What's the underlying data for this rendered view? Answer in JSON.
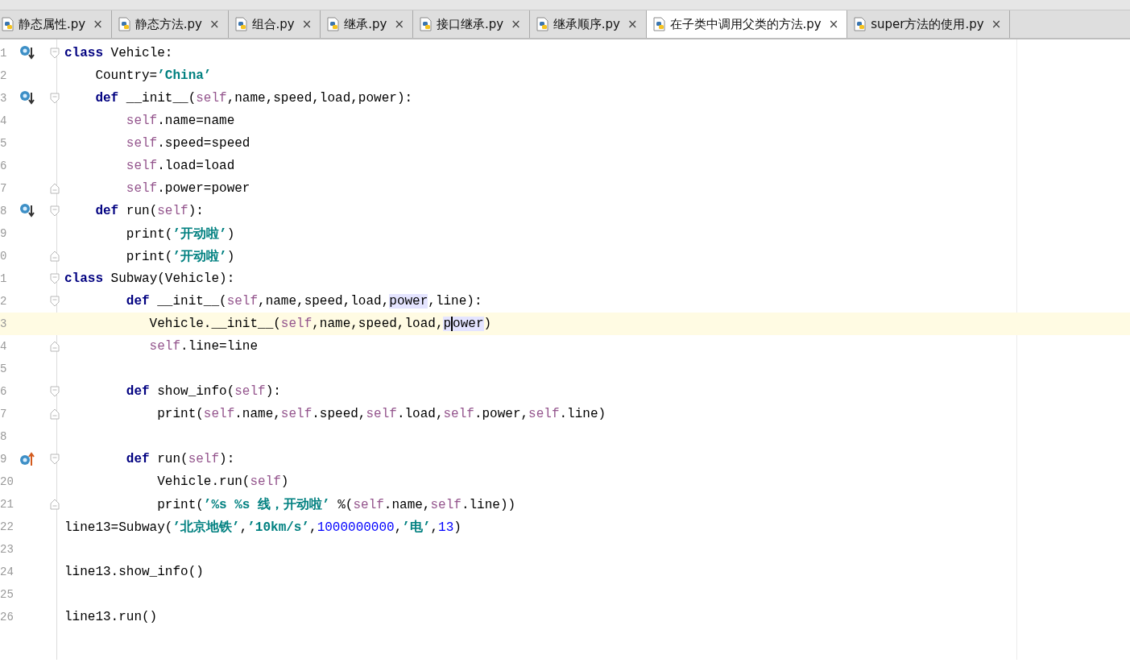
{
  "tabs": [
    {
      "label": "静态属性.py",
      "close": "×",
      "selected": false
    },
    {
      "label": "静态方法.py",
      "close": "×",
      "selected": false
    },
    {
      "label": "组合.py",
      "close": "×",
      "selected": false
    },
    {
      "label": "继承.py",
      "close": "×",
      "selected": false
    },
    {
      "label": "接口继承.py",
      "close": "×",
      "selected": false
    },
    {
      "label": "继承顺序.py",
      "close": "×",
      "selected": false
    },
    {
      "label": "在子类中调用父类的方法.py",
      "close": "×",
      "selected": true
    },
    {
      "label": "super方法的使用.py",
      "close": "×",
      "selected": false
    }
  ],
  "editor": {
    "lines": [
      {
        "number": "1",
        "current": false,
        "implemented": true,
        "overrides": false,
        "fold_start": true,
        "fold_end": false,
        "tokens": [
          {
            "kind": "kw",
            "text": "class"
          },
          {
            "kind": "plain",
            "text": " Vehicle:"
          }
        ]
      },
      {
        "number": "2",
        "current": false,
        "implemented": false,
        "overrides": false,
        "fold_start": false,
        "fold_end": false,
        "tokens": [
          {
            "kind": "plain",
            "text": "    Country="
          },
          {
            "kind": "str",
            "text": "’China’"
          }
        ]
      },
      {
        "number": "3",
        "current": false,
        "implemented": true,
        "overrides": false,
        "fold_start": true,
        "fold_end": false,
        "tokens": [
          {
            "kind": "kw",
            "text": "    def"
          },
          {
            "kind": "plain",
            "text": " __init__("
          },
          {
            "kind": "self",
            "text": "self"
          },
          {
            "kind": "plain",
            "text": ",name,speed,load,power):"
          }
        ]
      },
      {
        "number": "4",
        "current": false,
        "implemented": false,
        "overrides": false,
        "fold_start": false,
        "fold_end": false,
        "tokens": [
          {
            "kind": "self",
            "text": "        self"
          },
          {
            "kind": "plain",
            "text": ".name=name"
          }
        ]
      },
      {
        "number": "5",
        "current": false,
        "implemented": false,
        "overrides": false,
        "fold_start": false,
        "fold_end": false,
        "tokens": [
          {
            "kind": "self",
            "text": "        self"
          },
          {
            "kind": "plain",
            "text": ".speed=speed"
          }
        ]
      },
      {
        "number": "6",
        "current": false,
        "implemented": false,
        "overrides": false,
        "fold_start": false,
        "fold_end": false,
        "tokens": [
          {
            "kind": "self",
            "text": "        self"
          },
          {
            "kind": "plain",
            "text": ".load=load"
          }
        ]
      },
      {
        "number": "7",
        "current": false,
        "implemented": false,
        "overrides": false,
        "fold_start": false,
        "fold_end": true,
        "tokens": [
          {
            "kind": "self",
            "text": "        self"
          },
          {
            "kind": "plain",
            "text": ".power=power"
          }
        ]
      },
      {
        "number": "8",
        "current": false,
        "implemented": true,
        "overrides": false,
        "fold_start": true,
        "fold_end": false,
        "tokens": [
          {
            "kind": "kw",
            "text": "    def"
          },
          {
            "kind": "plain",
            "text": " run("
          },
          {
            "kind": "self",
            "text": "self"
          },
          {
            "kind": "plain",
            "text": "):"
          }
        ]
      },
      {
        "number": "9",
        "current": false,
        "implemented": false,
        "overrides": false,
        "fold_start": false,
        "fold_end": false,
        "tokens": [
          {
            "kind": "plain",
            "text": "        print("
          },
          {
            "kind": "str",
            "text": "’开动啦’"
          },
          {
            "kind": "plain",
            "text": ")"
          }
        ]
      },
      {
        "number": "0",
        "current": false,
        "implemented": false,
        "overrides": false,
        "fold_start": false,
        "fold_end": true,
        "tokens": [
          {
            "kind": "plain",
            "text": "        print("
          },
          {
            "kind": "str",
            "text": "’开动啦’"
          },
          {
            "kind": "plain",
            "text": ")"
          }
        ]
      },
      {
        "number": "1",
        "current": false,
        "implemented": false,
        "overrides": false,
        "fold_start": true,
        "fold_end": false,
        "tokens": [
          {
            "kind": "kw",
            "text": "class"
          },
          {
            "kind": "plain",
            "text": " Subway(Vehicle):"
          }
        ]
      },
      {
        "number": "2",
        "current": false,
        "implemented": false,
        "overrides": false,
        "fold_start": true,
        "fold_end": false,
        "tokens": [
          {
            "kind": "kw",
            "text": "        def"
          },
          {
            "kind": "plain",
            "text": " __init__("
          },
          {
            "kind": "self",
            "text": "self"
          },
          {
            "kind": "plain",
            "text": ",name,speed,load,"
          },
          {
            "kind": "usage",
            "text": "power"
          },
          {
            "kind": "plain",
            "text": ",line):"
          }
        ]
      },
      {
        "number": "3",
        "current": true,
        "implemented": false,
        "overrides": false,
        "fold_start": false,
        "fold_end": false,
        "tokens": [
          {
            "kind": "plain",
            "text": "           Vehicle.__init__("
          },
          {
            "kind": "self",
            "text": "self"
          },
          {
            "kind": "plain",
            "text": ",name,speed,load,"
          },
          {
            "kind": "usage",
            "text": "p"
          },
          {
            "kind": "caret"
          },
          {
            "kind": "usage",
            "text": "ower"
          },
          {
            "kind": "plain",
            "text": ")"
          }
        ]
      },
      {
        "number": "4",
        "current": false,
        "implemented": false,
        "overrides": false,
        "fold_start": false,
        "fold_end": true,
        "tokens": [
          {
            "kind": "self",
            "text": "           self"
          },
          {
            "kind": "plain",
            "text": ".line=line"
          }
        ]
      },
      {
        "number": "5",
        "current": false,
        "implemented": false,
        "overrides": false,
        "fold_start": false,
        "fold_end": false
      },
      {
        "number": "6",
        "current": false,
        "implemented": false,
        "overrides": false,
        "fold_start": true,
        "fold_end": false,
        "tokens": [
          {
            "kind": "kw",
            "text": "        def"
          },
          {
            "kind": "plain",
            "text": " show_info("
          },
          {
            "kind": "self",
            "text": "self"
          },
          {
            "kind": "plain",
            "text": "):"
          }
        ]
      },
      {
        "number": "7",
        "current": false,
        "implemented": false,
        "overrides": false,
        "fold_start": false,
        "fold_end": true,
        "tokens": [
          {
            "kind": "plain",
            "text": "            print("
          },
          {
            "kind": "self",
            "text": "self"
          },
          {
            "kind": "plain",
            "text": ".name,"
          },
          {
            "kind": "self",
            "text": "self"
          },
          {
            "kind": "plain",
            "text": ".speed,"
          },
          {
            "kind": "self",
            "text": "self"
          },
          {
            "kind": "plain",
            "text": ".load,"
          },
          {
            "kind": "self",
            "text": "self"
          },
          {
            "kind": "plain",
            "text": ".power,"
          },
          {
            "kind": "self",
            "text": "self"
          },
          {
            "kind": "plain",
            "text": ".line)"
          }
        ]
      },
      {
        "number": "8",
        "current": false,
        "implemented": false,
        "overrides": false,
        "fold_start": false,
        "fold_end": false
      },
      {
        "number": "9",
        "current": false,
        "implemented": false,
        "overrides": true,
        "fold_start": true,
        "fold_end": false,
        "tokens": [
          {
            "kind": "kw",
            "text": "        def"
          },
          {
            "kind": "plain",
            "text": " run("
          },
          {
            "kind": "self",
            "text": "self"
          },
          {
            "kind": "plain",
            "text": "):"
          }
        ]
      },
      {
        "number": "20",
        "current": false,
        "implemented": false,
        "overrides": false,
        "fold_start": false,
        "fold_end": false,
        "tokens": [
          {
            "kind": "plain",
            "text": "            Vehicle.run("
          },
          {
            "kind": "self",
            "text": "self"
          },
          {
            "kind": "plain",
            "text": ")"
          }
        ]
      },
      {
        "number": "21",
        "current": false,
        "implemented": false,
        "overrides": false,
        "fold_start": false,
        "fold_end": true,
        "tokens": [
          {
            "kind": "plain",
            "text": "            print("
          },
          {
            "kind": "str",
            "text": "’%s %s 线，开动啦’"
          },
          {
            "kind": "plain",
            "text": " %("
          },
          {
            "kind": "self",
            "text": "self"
          },
          {
            "kind": "plain",
            "text": ".name,"
          },
          {
            "kind": "self",
            "text": "self"
          },
          {
            "kind": "plain",
            "text": ".line))"
          }
        ]
      },
      {
        "number": "22",
        "current": false,
        "implemented": false,
        "overrides": false,
        "fold_start": false,
        "fold_end": false,
        "tokens": [
          {
            "kind": "plain",
            "text": "line13=Subway("
          },
          {
            "kind": "str",
            "text": "’北京地铁’"
          },
          {
            "kind": "plain",
            "text": ","
          },
          {
            "kind": "str",
            "text": "’10km/s’"
          },
          {
            "kind": "plain",
            "text": ","
          },
          {
            "kind": "num",
            "text": "1000000000"
          },
          {
            "kind": "plain",
            "text": ","
          },
          {
            "kind": "str",
            "text": "’电’"
          },
          {
            "kind": "plain",
            "text": ","
          },
          {
            "kind": "num",
            "text": "13"
          },
          {
            "kind": "plain",
            "text": ")"
          }
        ]
      },
      {
        "number": "23",
        "current": false,
        "implemented": false,
        "overrides": false,
        "fold_start": false,
        "fold_end": false
      },
      {
        "number": "24",
        "current": false,
        "implemented": false,
        "overrides": false,
        "fold_start": false,
        "fold_end": false,
        "tokens": [
          {
            "kind": "plain",
            "text": "line13.show_info()"
          }
        ]
      },
      {
        "number": "25",
        "current": false,
        "implemented": false,
        "overrides": false,
        "fold_start": false,
        "fold_end": false
      },
      {
        "number": "26",
        "current": false,
        "implemented": false,
        "overrides": false,
        "fold_start": false,
        "fold_end": false,
        "tokens": [
          {
            "kind": "plain",
            "text": "line13.run()"
          }
        ]
      }
    ]
  }
}
